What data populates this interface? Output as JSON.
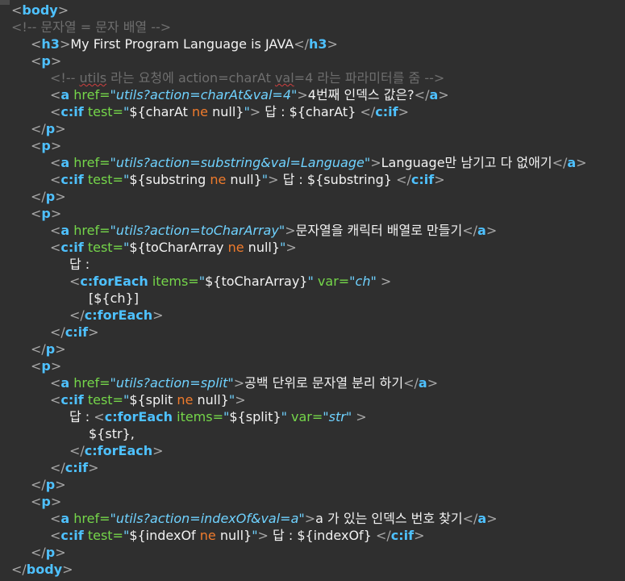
{
  "editor": {
    "lines": [
      {
        "indent": 0,
        "tokens": [
          {
            "t": "punc",
            "v": "<"
          },
          {
            "t": "tag",
            "v": "body"
          },
          {
            "t": "punc",
            "v": ">"
          }
        ]
      },
      {
        "indent": 0,
        "tokens": [
          {
            "t": "cmt",
            "v": "<!-- 문자열 = 문자 배열 -->"
          }
        ]
      },
      {
        "indent": 1,
        "tokens": [
          {
            "t": "punc",
            "v": "<"
          },
          {
            "t": "tag",
            "v": "h3"
          },
          {
            "t": "punc",
            "v": ">"
          },
          {
            "t": "txt",
            "v": "My First Program Language is JAVA"
          },
          {
            "t": "punc",
            "v": "</"
          },
          {
            "t": "tag",
            "v": "h3"
          },
          {
            "t": "punc",
            "v": ">"
          }
        ]
      },
      {
        "indent": 1,
        "tokens": [
          {
            "t": "punc",
            "v": "<"
          },
          {
            "t": "tag",
            "v": "p"
          },
          {
            "t": "punc",
            "v": ">"
          }
        ]
      },
      {
        "indent": 2,
        "tokens": [
          {
            "t": "cmt",
            "v": "<!-- "
          },
          {
            "t": "cmt squig",
            "v": "utils"
          },
          {
            "t": "cmt",
            "v": " 라는 요청에 action=charAt "
          },
          {
            "t": "cmt squig",
            "v": "val"
          },
          {
            "t": "cmt",
            "v": "=4 라는 파라미터를 줌 -->"
          }
        ]
      },
      {
        "indent": 2,
        "tokens": [
          {
            "t": "punc",
            "v": "<"
          },
          {
            "t": "tag",
            "v": "a"
          },
          {
            "t": "attr",
            "v": " href="
          },
          {
            "t": "str",
            "v": "\"utils?action=charAt&val=4\""
          },
          {
            "t": "punc",
            "v": ">"
          },
          {
            "t": "txt",
            "v": "4번째 인덱스 값은?"
          },
          {
            "t": "punc",
            "v": "</"
          },
          {
            "t": "tag",
            "v": "a"
          },
          {
            "t": "punc",
            "v": ">"
          }
        ]
      },
      {
        "indent": 2,
        "tokens": [
          {
            "t": "punc",
            "v": "<"
          },
          {
            "t": "tag",
            "v": "c:if"
          },
          {
            "t": "attr",
            "v": " test="
          },
          {
            "t": "str",
            "v": "\""
          },
          {
            "t": "el",
            "v": "${charAt "
          },
          {
            "t": "kw",
            "v": "ne"
          },
          {
            "t": "el",
            "v": " null}"
          },
          {
            "t": "str",
            "v": "\""
          },
          {
            "t": "punc",
            "v": ">"
          },
          {
            "t": "txt",
            "v": " 답 : ${charAt} "
          },
          {
            "t": "punc",
            "v": "</"
          },
          {
            "t": "tag",
            "v": "c:if"
          },
          {
            "t": "punc",
            "v": ">"
          }
        ]
      },
      {
        "indent": 1,
        "tokens": [
          {
            "t": "punc",
            "v": "</"
          },
          {
            "t": "tag",
            "v": "p"
          },
          {
            "t": "punc",
            "v": ">"
          }
        ]
      },
      {
        "indent": 1,
        "tokens": [
          {
            "t": "punc",
            "v": "<"
          },
          {
            "t": "tag",
            "v": "p"
          },
          {
            "t": "punc",
            "v": ">"
          }
        ]
      },
      {
        "indent": 2,
        "tokens": [
          {
            "t": "punc",
            "v": "<"
          },
          {
            "t": "tag",
            "v": "a"
          },
          {
            "t": "attr",
            "v": " href="
          },
          {
            "t": "str",
            "v": "\"utils?action=substring&val=Language\""
          },
          {
            "t": "punc",
            "v": ">"
          },
          {
            "t": "txt",
            "v": "Language만 남기고 다 없애기"
          },
          {
            "t": "punc",
            "v": "</"
          },
          {
            "t": "tag",
            "v": "a"
          },
          {
            "t": "punc",
            "v": ">"
          }
        ]
      },
      {
        "indent": 2,
        "tokens": [
          {
            "t": "punc",
            "v": "<"
          },
          {
            "t": "tag",
            "v": "c:if"
          },
          {
            "t": "attr",
            "v": " test="
          },
          {
            "t": "str",
            "v": "\""
          },
          {
            "t": "el",
            "v": "${substring "
          },
          {
            "t": "kw",
            "v": "ne"
          },
          {
            "t": "el",
            "v": " null}"
          },
          {
            "t": "str",
            "v": "\""
          },
          {
            "t": "punc",
            "v": ">"
          },
          {
            "t": "txt",
            "v": " 답 : ${substring} "
          },
          {
            "t": "punc",
            "v": "</"
          },
          {
            "t": "tag",
            "v": "c:if"
          },
          {
            "t": "punc",
            "v": ">"
          }
        ]
      },
      {
        "indent": 1,
        "tokens": [
          {
            "t": "punc",
            "v": "</"
          },
          {
            "t": "tag",
            "v": "p"
          },
          {
            "t": "punc",
            "v": ">"
          }
        ]
      },
      {
        "indent": 1,
        "tokens": [
          {
            "t": "punc",
            "v": "<"
          },
          {
            "t": "tag",
            "v": "p"
          },
          {
            "t": "punc",
            "v": ">"
          }
        ]
      },
      {
        "indent": 2,
        "tokens": [
          {
            "t": "punc",
            "v": "<"
          },
          {
            "t": "tag",
            "v": "a"
          },
          {
            "t": "attr",
            "v": " href="
          },
          {
            "t": "str",
            "v": "\"utils?action=toCharArray\""
          },
          {
            "t": "punc",
            "v": ">"
          },
          {
            "t": "txt",
            "v": "문자열을 캐릭터 배열로 만들기"
          },
          {
            "t": "punc",
            "v": "</"
          },
          {
            "t": "tag",
            "v": "a"
          },
          {
            "t": "punc",
            "v": ">"
          }
        ]
      },
      {
        "indent": 2,
        "tokens": [
          {
            "t": "punc",
            "v": "<"
          },
          {
            "t": "tag",
            "v": "c:if"
          },
          {
            "t": "attr",
            "v": " test="
          },
          {
            "t": "str",
            "v": "\""
          },
          {
            "t": "el",
            "v": "${toCharArray "
          },
          {
            "t": "kw",
            "v": "ne"
          },
          {
            "t": "el",
            "v": " null}"
          },
          {
            "t": "str",
            "v": "\""
          },
          {
            "t": "punc",
            "v": ">"
          }
        ]
      },
      {
        "indent": 3,
        "tokens": [
          {
            "t": "txt",
            "v": "답 :"
          }
        ]
      },
      {
        "indent": 3,
        "tokens": [
          {
            "t": "punc",
            "v": "<"
          },
          {
            "t": "tag",
            "v": "c:forEach"
          },
          {
            "t": "attr",
            "v": " items="
          },
          {
            "t": "str",
            "v": "\""
          },
          {
            "t": "el",
            "v": "${toCharArray}"
          },
          {
            "t": "str",
            "v": "\""
          },
          {
            "t": "attr",
            "v": " var="
          },
          {
            "t": "str",
            "v": "\"ch\""
          },
          {
            "t": "punc",
            "v": " >"
          }
        ]
      },
      {
        "indent": 4,
        "tokens": [
          {
            "t": "txt",
            "v": "[${ch}]"
          }
        ]
      },
      {
        "indent": 3,
        "tokens": [
          {
            "t": "punc",
            "v": "</"
          },
          {
            "t": "tag",
            "v": "c:forEach"
          },
          {
            "t": "punc",
            "v": ">"
          }
        ]
      },
      {
        "indent": 2,
        "tokens": [
          {
            "t": "punc",
            "v": "</"
          },
          {
            "t": "tag",
            "v": "c:if"
          },
          {
            "t": "punc",
            "v": ">"
          }
        ]
      },
      {
        "indent": 1,
        "tokens": [
          {
            "t": "punc",
            "v": "</"
          },
          {
            "t": "tag",
            "v": "p"
          },
          {
            "t": "punc",
            "v": ">"
          }
        ]
      },
      {
        "indent": 1,
        "tokens": [
          {
            "t": "punc",
            "v": "<"
          },
          {
            "t": "tag",
            "v": "p"
          },
          {
            "t": "punc",
            "v": ">"
          }
        ]
      },
      {
        "indent": 2,
        "tokens": [
          {
            "t": "punc",
            "v": "<"
          },
          {
            "t": "tag",
            "v": "a"
          },
          {
            "t": "attr",
            "v": " href="
          },
          {
            "t": "str",
            "v": "\"utils?action=split\""
          },
          {
            "t": "punc",
            "v": ">"
          },
          {
            "t": "txt",
            "v": "공백 단위로 문자열 분리 하기"
          },
          {
            "t": "punc",
            "v": "</"
          },
          {
            "t": "tag",
            "v": "a"
          },
          {
            "t": "punc",
            "v": ">"
          }
        ]
      },
      {
        "indent": 2,
        "tokens": [
          {
            "t": "punc",
            "v": "<"
          },
          {
            "t": "tag",
            "v": "c:if"
          },
          {
            "t": "attr",
            "v": " test="
          },
          {
            "t": "str",
            "v": "\""
          },
          {
            "t": "el",
            "v": "${split "
          },
          {
            "t": "kw",
            "v": "ne"
          },
          {
            "t": "el",
            "v": " null}"
          },
          {
            "t": "str",
            "v": "\""
          },
          {
            "t": "punc",
            "v": ">"
          }
        ]
      },
      {
        "indent": 3,
        "tokens": [
          {
            "t": "txt",
            "v": "답 : "
          },
          {
            "t": "punc",
            "v": "<"
          },
          {
            "t": "tag",
            "v": "c:forEach"
          },
          {
            "t": "attr",
            "v": " items="
          },
          {
            "t": "str",
            "v": "\""
          },
          {
            "t": "el",
            "v": "${split}"
          },
          {
            "t": "str",
            "v": "\""
          },
          {
            "t": "attr",
            "v": " var="
          },
          {
            "t": "str",
            "v": "\"str\""
          },
          {
            "t": "punc",
            "v": " >"
          }
        ]
      },
      {
        "indent": 4,
        "tokens": [
          {
            "t": "txt",
            "v": "${str},"
          }
        ]
      },
      {
        "indent": 3,
        "tokens": [
          {
            "t": "punc",
            "v": "</"
          },
          {
            "t": "tag",
            "v": "c:forEach"
          },
          {
            "t": "punc",
            "v": ">"
          }
        ]
      },
      {
        "indent": 2,
        "tokens": [
          {
            "t": "punc",
            "v": "</"
          },
          {
            "t": "tag",
            "v": "c:if"
          },
          {
            "t": "punc",
            "v": ">"
          }
        ]
      },
      {
        "indent": 1,
        "tokens": [
          {
            "t": "punc",
            "v": "</"
          },
          {
            "t": "tag",
            "v": "p"
          },
          {
            "t": "punc",
            "v": ">"
          }
        ]
      },
      {
        "indent": 1,
        "tokens": [
          {
            "t": "punc",
            "v": "<"
          },
          {
            "t": "tag",
            "v": "p"
          },
          {
            "t": "punc",
            "v": ">"
          }
        ]
      },
      {
        "indent": 2,
        "tokens": [
          {
            "t": "punc",
            "v": "<"
          },
          {
            "t": "tag",
            "v": "a"
          },
          {
            "t": "attr",
            "v": " href="
          },
          {
            "t": "str",
            "v": "\"utils?action=indexOf&val=a\""
          },
          {
            "t": "punc",
            "v": ">"
          },
          {
            "t": "txt",
            "v": "a 가 있는 인덱스 번호 찾기"
          },
          {
            "t": "punc",
            "v": "</"
          },
          {
            "t": "tag",
            "v": "a"
          },
          {
            "t": "punc",
            "v": ">"
          }
        ]
      },
      {
        "indent": 2,
        "tokens": [
          {
            "t": "punc",
            "v": "<"
          },
          {
            "t": "tag",
            "v": "c:if"
          },
          {
            "t": "attr",
            "v": " test="
          },
          {
            "t": "str",
            "v": "\""
          },
          {
            "t": "el",
            "v": "${indexOf "
          },
          {
            "t": "kw",
            "v": "ne"
          },
          {
            "t": "el",
            "v": " null}"
          },
          {
            "t": "str",
            "v": "\""
          },
          {
            "t": "punc",
            "v": ">"
          },
          {
            "t": "txt",
            "v": " 답 : ${indexOf} "
          },
          {
            "t": "punc",
            "v": "</"
          },
          {
            "t": "tag",
            "v": "c:if"
          },
          {
            "t": "punc",
            "v": ">"
          }
        ]
      },
      {
        "indent": 1,
        "tokens": [
          {
            "t": "punc",
            "v": "</"
          },
          {
            "t": "tag",
            "v": "p"
          },
          {
            "t": "punc",
            "v": ">"
          }
        ]
      },
      {
        "indent": 0,
        "tokens": [
          {
            "t": "punc",
            "v": "</"
          },
          {
            "t": "tag",
            "v": "body"
          },
          {
            "t": "punc",
            "v": ">"
          }
        ]
      }
    ]
  }
}
